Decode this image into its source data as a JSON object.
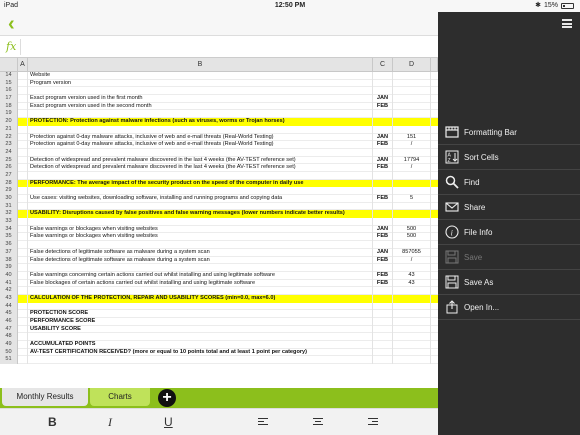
{
  "status": {
    "device": "iPad",
    "time": "12:50 PM",
    "battery": "15%"
  },
  "sheet": {
    "columns": [
      "A",
      "B",
      "C",
      "D"
    ],
    "rows": [
      {
        "n": "14",
        "b": "Website",
        "c": "",
        "d": "",
        "bold": false,
        "hl": false
      },
      {
        "n": "15",
        "b": "Program version",
        "c": "",
        "d": "",
        "bold": false,
        "hl": false
      },
      {
        "n": "16",
        "b": "",
        "c": "",
        "d": "",
        "bold": false,
        "hl": false
      },
      {
        "n": "17",
        "b": "Exact program version used in the first month",
        "c": "JAN",
        "d": "",
        "bold": false,
        "hl": false
      },
      {
        "n": "18",
        "b": "Exact program version used in the second month",
        "c": "FEB",
        "d": "",
        "bold": false,
        "hl": false
      },
      {
        "n": "19",
        "b": "",
        "c": "",
        "d": "",
        "bold": false,
        "hl": false
      },
      {
        "n": "20",
        "b": "PROTECTION: Protection against malware infections (such as viruses, worms or Trojan horses)",
        "c": "",
        "d": "",
        "bold": true,
        "hl": true
      },
      {
        "n": "21",
        "b": "",
        "c": "",
        "d": "",
        "bold": false,
        "hl": false
      },
      {
        "n": "22",
        "b": "Protection against 0-day malware attacks, inclusive of web and e-mail threats (Real-World Testing)",
        "c": "JAN",
        "d": "151",
        "bold": false,
        "hl": false
      },
      {
        "n": "23",
        "b": "Protection against 0-day malware attacks, inclusive of web and e-mail threats (Real-World Testing)",
        "c": "FEB",
        "d": "/",
        "bold": false,
        "hl": false
      },
      {
        "n": "24",
        "b": "",
        "c": "",
        "d": "",
        "bold": false,
        "hl": false
      },
      {
        "n": "25",
        "b": "Detection of widespread and prevalent malware discovered in the last 4 weeks (the AV-TEST reference set)",
        "c": "JAN",
        "d": "17794",
        "bold": false,
        "hl": false
      },
      {
        "n": "26",
        "b": "Detection of widespread and prevalent malware discovered in the last 4 weeks (the AV-TEST reference set)",
        "c": "FEB",
        "d": "/",
        "bold": false,
        "hl": false
      },
      {
        "n": "27",
        "b": "",
        "c": "",
        "d": "",
        "bold": false,
        "hl": false
      },
      {
        "n": "28",
        "b": "PERFORMANCE: The average impact of the security product on the speed of the computer in daily use",
        "c": "",
        "d": "",
        "bold": true,
        "hl": true
      },
      {
        "n": "29",
        "b": "",
        "c": "",
        "d": "",
        "bold": false,
        "hl": false
      },
      {
        "n": "30",
        "b": "Use cases: visiting websites, downloading software, installing and running programs and copying data",
        "c": "FEB",
        "d": "5",
        "bold": false,
        "hl": false
      },
      {
        "n": "31",
        "b": "",
        "c": "",
        "d": "",
        "bold": false,
        "hl": false
      },
      {
        "n": "32",
        "b": "USABILITY: Disruptions caused by false positives and false warning messages (lower numbers indicate better results)",
        "c": "",
        "d": "",
        "bold": true,
        "hl": true
      },
      {
        "n": "33",
        "b": "",
        "c": "",
        "d": "",
        "bold": false,
        "hl": false
      },
      {
        "n": "34",
        "b": "False warnings or blockages when visiting websites",
        "c": "JAN",
        "d": "500",
        "bold": false,
        "hl": false
      },
      {
        "n": "35",
        "b": "False warnings or blockages when visiting websites",
        "c": "FEB",
        "d": "500",
        "bold": false,
        "hl": false
      },
      {
        "n": "36",
        "b": "",
        "c": "",
        "d": "",
        "bold": false,
        "hl": false
      },
      {
        "n": "37",
        "b": "False detections of legitimate software as malware during a system scan",
        "c": "JAN",
        "d": "857055",
        "bold": false,
        "hl": false
      },
      {
        "n": "38",
        "b": "False detections of legitimate software as malware during a system scan",
        "c": "FEB",
        "d": "/",
        "bold": false,
        "hl": false
      },
      {
        "n": "39",
        "b": "",
        "c": "",
        "d": "",
        "bold": false,
        "hl": false
      },
      {
        "n": "40",
        "b": "False warnings concerning certain actions carried out whilst installing and using legitimate software",
        "c": "FEB",
        "d": "43",
        "bold": false,
        "hl": false
      },
      {
        "n": "41",
        "b": "False blockages of certain actions carried out whilst installing and using legitimate software",
        "c": "FEB",
        "d": "43",
        "bold": false,
        "hl": false
      },
      {
        "n": "42",
        "b": "",
        "c": "",
        "d": "",
        "bold": false,
        "hl": false
      },
      {
        "n": "43",
        "b": "CALCULATION OF THE PROTECTION, REPAIR AND USABILITY SCORES (min=0.0, max=6.0)",
        "c": "",
        "d": "",
        "bold": true,
        "hl": true
      },
      {
        "n": "44",
        "b": "",
        "c": "",
        "d": "",
        "bold": false,
        "hl": false
      },
      {
        "n": "45",
        "b": "PROTECTION SCORE",
        "c": "",
        "d": "",
        "bold": true,
        "hl": false
      },
      {
        "n": "46",
        "b": "PERFORMANCE SCORE",
        "c": "",
        "d": "",
        "bold": true,
        "hl": false
      },
      {
        "n": "47",
        "b": "USABILITY SCORE",
        "c": "",
        "d": "",
        "bold": true,
        "hl": false
      },
      {
        "n": "48",
        "b": "",
        "c": "",
        "d": "",
        "bold": false,
        "hl": false
      },
      {
        "n": "49",
        "b": "ACCUMULATED POINTS",
        "c": "",
        "d": "",
        "bold": true,
        "hl": false
      },
      {
        "n": "50",
        "b": "AV-TEST CERTIFICATION RECEIVED? (more or equal to 10 points total and at least 1 point per category)",
        "c": "",
        "d": "",
        "bold": true,
        "hl": false
      },
      {
        "n": "51",
        "b": "",
        "c": "",
        "d": "",
        "bold": false,
        "hl": false
      }
    ]
  },
  "tabs": [
    {
      "label": "Monthly Results",
      "active": true
    },
    {
      "label": "Charts",
      "active": false
    }
  ],
  "format": {
    "bold": "B",
    "italic": "I",
    "underline": "U"
  },
  "menu": {
    "items": [
      {
        "label": "Formatting Bar",
        "icon": "formatting-bar-icon",
        "enabled": true
      },
      {
        "label": "Sort Cells",
        "icon": "sort-cells-icon",
        "enabled": true
      },
      {
        "label": "Find",
        "icon": "search-icon",
        "enabled": true
      },
      {
        "label": "Share",
        "icon": "envelope-icon",
        "enabled": true
      },
      {
        "label": "File Info",
        "icon": "info-icon",
        "enabled": true
      },
      {
        "label": "Save",
        "icon": "save-icon",
        "enabled": false
      },
      {
        "label": "Save As",
        "icon": "save-as-icon",
        "enabled": true
      },
      {
        "label": "Open In...",
        "icon": "share-icon",
        "enabled": true
      }
    ]
  },
  "colors": {
    "accent": "#8cbf1c",
    "highlight": "#ffff00",
    "menu_bg": "#2d2d2d"
  }
}
